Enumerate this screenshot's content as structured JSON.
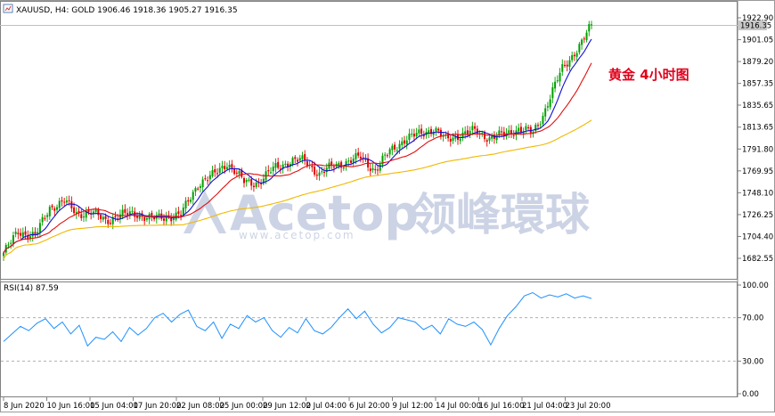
{
  "header": {
    "symbol_text": "XAUUSD, H4:  GOLD  1906.46  1918.36  1905.27  1916.35",
    "icon": "chart-window-icon"
  },
  "annotation": {
    "label": "黄金 4小时图",
    "color": "#e0001b"
  },
  "watermark": {
    "brand": "Acetop",
    "brand_cn": "领峰環球",
    "url": "www.acetop.com"
  },
  "chart_data": [
    {
      "type": "candlestick",
      "symbol": "XAUUSD",
      "timeframe": "H4",
      "name": "GOLD",
      "ohlc_current": {
        "open": 1906.46,
        "high": 1918.36,
        "low": 1905.27,
        "close": 1916.35
      },
      "price_badge": "1916.35",
      "y_ticks": [
        1922.9,
        1901.05,
        1879.2,
        1857.35,
        1835.65,
        1813.65,
        1791.8,
        1769.95,
        1748.1,
        1726.25,
        1704.4,
        1682.55
      ],
      "x_tick_labels": [
        "8 Jun 2020",
        "10 Jun 16:00",
        "15 Jun 04:00",
        "17 Jun 20:00",
        "22 Jun 08:00",
        "25 Jun 00:00",
        "29 Jun 12:00",
        "2 Jul 04:00",
        "6 Jul 20:00",
        "9 Jul 12:00",
        "14 Jul 00:00",
        "16 Jul 16:00",
        "21 Jul 04:00",
        "23 Jul 20:00"
      ],
      "up_color": "#00a000",
      "down_color": "#e00000",
      "close_path": [
        [
          0,
          1688
        ],
        [
          6,
          1709
        ],
        [
          13,
          1705
        ],
        [
          19,
          1733
        ],
        [
          25,
          1740
        ],
        [
          30,
          1727
        ],
        [
          36,
          1729
        ],
        [
          42,
          1720
        ],
        [
          48,
          1726
        ],
        [
          55,
          1727
        ],
        [
          61,
          1722
        ],
        [
          67,
          1724
        ],
        [
          73,
          1726
        ],
        [
          80,
          1757
        ],
        [
          86,
          1765
        ],
        [
          92,
          1778
        ],
        [
          99,
          1759
        ],
        [
          105,
          1758
        ],
        [
          112,
          1774
        ],
        [
          118,
          1779
        ],
        [
          124,
          1781
        ],
        [
          130,
          1766
        ],
        [
          136,
          1776
        ],
        [
          142,
          1779
        ],
        [
          147,
          1784
        ],
        [
          153,
          1770
        ],
        [
          159,
          1790
        ],
        [
          165,
          1801
        ],
        [
          171,
          1807
        ],
        [
          177,
          1812
        ],
        [
          182,
          1801
        ],
        [
          188,
          1806
        ],
        [
          194,
          1810
        ],
        [
          200,
          1803
        ],
        [
          206,
          1806
        ],
        [
          212,
          1812
        ],
        [
          218,
          1808
        ],
        [
          222,
          1826
        ],
        [
          226,
          1850
        ],
        [
          230,
          1872
        ],
        [
          234,
          1885
        ],
        [
          238,
          1898
        ],
        [
          242,
          1916
        ]
      ],
      "indicators": [
        {
          "label": "MA fast",
          "color": "#1010d0"
        },
        {
          "label": "MA mid",
          "color": "#e01010"
        },
        {
          "label": "MA slow",
          "color": "#f0b800"
        }
      ]
    },
    {
      "type": "line",
      "title": "RSI(14) 87.59",
      "indicator": "RSI(14)",
      "last_value": 87.59,
      "y_ticks": [
        100.0,
        70.0,
        30.0,
        0.0
      ],
      "levels": [
        70,
        30
      ],
      "line_color": "#1e90ff",
      "values": [
        48,
        55,
        62,
        58,
        65,
        69,
        60,
        66,
        55,
        63,
        44,
        52,
        50,
        57,
        48,
        61,
        54,
        60,
        70,
        74,
        66,
        73,
        77,
        62,
        58,
        66,
        51,
        64,
        60,
        72,
        66,
        70,
        58,
        52,
        61,
        56,
        69,
        58,
        55,
        61,
        70,
        78,
        69,
        76,
        64,
        56,
        61,
        70,
        68,
        66,
        59,
        63,
        55,
        69,
        64,
        62,
        66,
        59,
        45,
        60,
        72,
        80,
        90,
        93,
        88,
        91,
        89,
        92,
        88,
        90,
        87.59
      ]
    }
  ]
}
